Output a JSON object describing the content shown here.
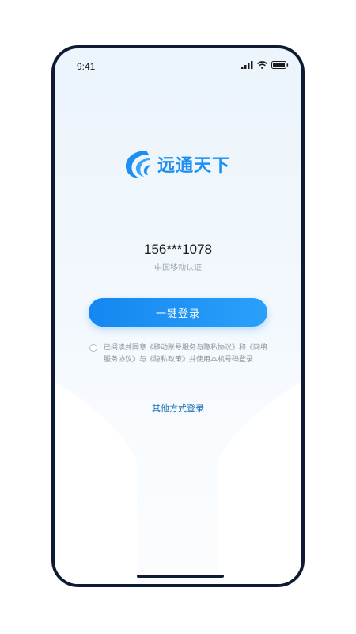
{
  "status_bar": {
    "time": "9:41",
    "icons": [
      "signal-icon",
      "wifi-icon",
      "battery-icon"
    ]
  },
  "brand": {
    "logo_icon": "wave-logo-icon",
    "name": "远通天下",
    "color": "#1d8ff2"
  },
  "login": {
    "phone_number": "156***1078",
    "auth_provider": "中国移动认证",
    "one_click_label": "一键登录",
    "button_color": "#1a8ff2"
  },
  "agreement": {
    "checked": false,
    "text": "已阅读并同意《移动账号服务与隐私协议》和《网络服务协议》与《隐私政策》并使用本机号码登录"
  },
  "other_login": {
    "label": "其他方式登录"
  }
}
